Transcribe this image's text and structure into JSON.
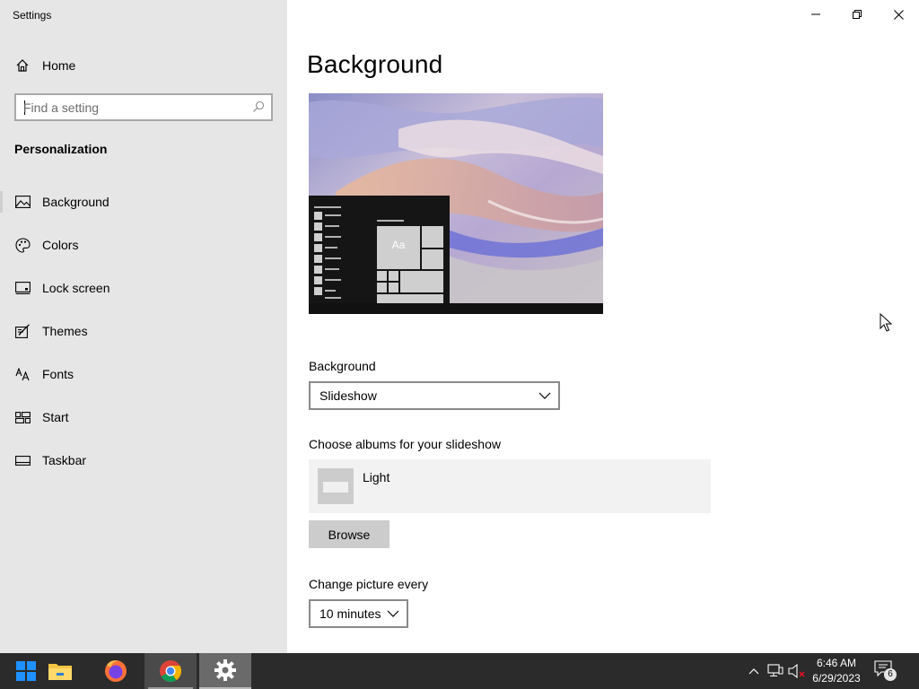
{
  "window": {
    "title": "Settings",
    "controls": {
      "minimize": "minimize-icon",
      "maximize": "restore-icon",
      "close": "close-icon"
    }
  },
  "sidebar": {
    "home_label": "Home",
    "search": {
      "placeholder": "Find a setting",
      "value": ""
    },
    "section_title": "Personalization",
    "items": [
      {
        "label": "Background",
        "icon": "picture-icon",
        "active": true
      },
      {
        "label": "Colors",
        "icon": "palette-icon",
        "active": false
      },
      {
        "label": "Lock screen",
        "icon": "lock-screen-icon",
        "active": false
      },
      {
        "label": "Themes",
        "icon": "brush-icon",
        "active": false
      },
      {
        "label": "Fonts",
        "icon": "font-icon",
        "active": false
      },
      {
        "label": "Start",
        "icon": "start-tiles-icon",
        "active": false
      },
      {
        "label": "Taskbar",
        "icon": "taskbar-icon",
        "active": false
      }
    ]
  },
  "main": {
    "title": "Background",
    "preview": {
      "tile_label": "Aa"
    },
    "background_label": "Background",
    "background_select": {
      "value": "Slideshow"
    },
    "albums_label": "Choose albums for your slideshow",
    "album": {
      "name": "Light"
    },
    "browse_label": "Browse",
    "interval_label": "Change picture every",
    "interval_select": {
      "value": "10 minutes"
    }
  },
  "taskbar": {
    "apps": [
      {
        "name": "Start",
        "icon": "windows-logo-icon",
        "state": "none"
      },
      {
        "name": "File Explorer",
        "icon": "folder-icon",
        "state": "none"
      },
      {
        "name": "Firefox",
        "icon": "firefox-icon",
        "state": "none"
      },
      {
        "name": "Chrome",
        "icon": "chrome-icon",
        "state": "running"
      },
      {
        "name": "Settings",
        "icon": "gear-icon",
        "state": "active"
      }
    ],
    "tray": {
      "time": "6:46 AM",
      "date": "6/29/2023",
      "notification_count": "6"
    }
  },
  "colors": {
    "sidebar_bg": "#e6e6e6",
    "taskbar_bg": "#2b2b2b",
    "accent": "#0078d7"
  }
}
